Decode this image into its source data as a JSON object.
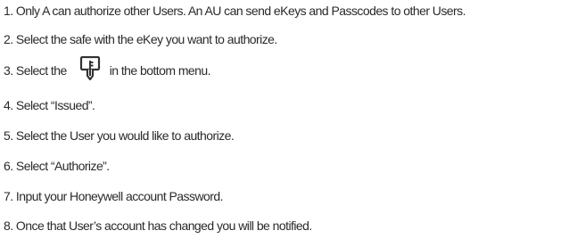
{
  "steps": [
    {
      "num": "1.",
      "text": "Only A can authorize other Users. An  AU can send eKeys and Passcodes to other Users."
    },
    {
      "num": "2.",
      "text": "Select the safe with the eKey you want to authorize."
    },
    {
      "num": "3.",
      "text_before": "Select the",
      "icon": "key-icon",
      "text_after": "in the bottom menu."
    },
    {
      "num": "4.",
      "text": "Select “Issued”."
    },
    {
      "num": "5.",
      "text": "Select the User you would like to authorize."
    },
    {
      "num": "6.",
      "text": " Select “Authorize”."
    },
    {
      "num": "7.",
      "text": "Input your Honeywell account Password."
    },
    {
      "num": "8.",
      "text": "Once that User’s account has changed you will be notified."
    }
  ]
}
